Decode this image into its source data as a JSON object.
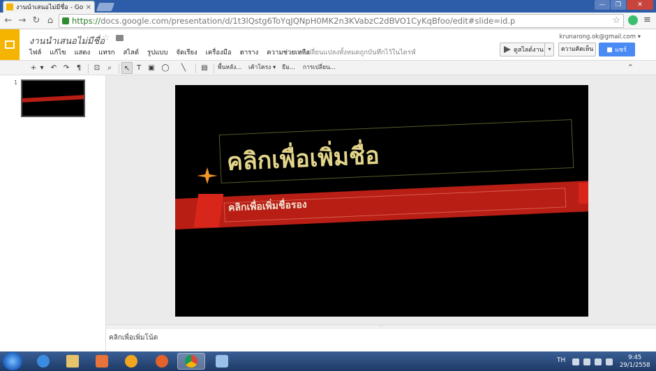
{
  "browser": {
    "tab_title": "งานนำเสนอไม่มีชื่อ - Google",
    "tab_close": "×",
    "url_scheme": "https://",
    "url_rest": "docs.google.com/presentation/d/1t3lQstg6ToYqJQNpH0MK2n3KVabzC2dBVO1CyKqBfoo/edit#slide=id.p",
    "window_buttons": [
      "—",
      "❐",
      "✕"
    ]
  },
  "header": {
    "doc_title": "งานนำเสนอไม่มีชื่อ",
    "account": "krunarong.ok@gmail.com ▾",
    "menus": [
      "ไฟล์",
      "แก้ไข",
      "แสดง",
      "แทรก",
      "สไลด์",
      "รูปแบบ",
      "จัดเรียง",
      "เครื่องมือ",
      "ตาราง",
      "ความช่วยเหลือ"
    ],
    "save_status": "การเปลี่ยนแปลงทั้งหมดถูกบันทึกไว้ในไดรฟ์",
    "present_label": "ดูสไลด์งาน",
    "comments_label": "ความคิดเห็น",
    "share_label": "แชร์"
  },
  "toolbar": {
    "background_label": "พื้นหลัง...",
    "layout_label": "เค้าโครง ▾",
    "theme_label": "ธีม...",
    "transition_label": "การเปลี่ยน..."
  },
  "filmstrip": {
    "slides": [
      {
        "number": "1"
      }
    ]
  },
  "slide": {
    "title_placeholder": "คลิกเพื่อเพิ่มชื่อ",
    "subtitle_placeholder": "คลิกเพื่อเพิ่มชื่อรอง",
    "colors": {
      "background": "#000000",
      "band": "#b81e14",
      "title": "#e3d58a",
      "accent": "#f0962a"
    }
  },
  "notes": {
    "placeholder": "คลิกเพื่อเพิ่มโน้ต"
  },
  "taskbar": {
    "language": "TH",
    "time": "9:45",
    "date": "29/1/2558"
  }
}
